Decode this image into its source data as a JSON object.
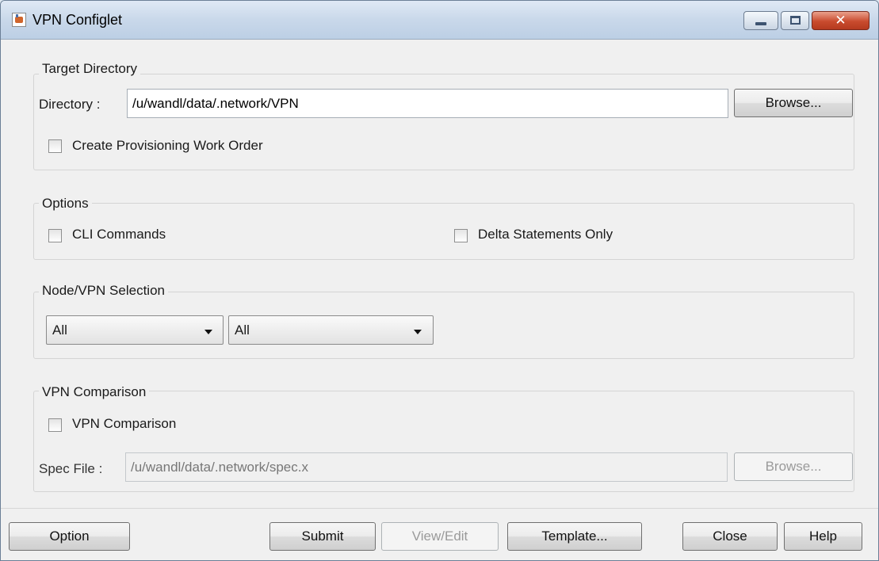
{
  "window": {
    "title": "VPN Configlet"
  },
  "target_directory": {
    "group_title": "Target Directory",
    "directory_label": "Directory :",
    "directory_value": "/u/wandl/data/.network/VPN",
    "browse_label": "Browse...",
    "create_work_order_label": "Create Provisioning Work Order"
  },
  "options": {
    "group_title": "Options",
    "cli_commands_label": "CLI Commands",
    "delta_statements_label": "Delta Statements Only"
  },
  "selection": {
    "group_title": "Node/VPN Selection",
    "node_value": "All",
    "vpn_value": "All"
  },
  "comparison": {
    "group_title": "VPN Comparison",
    "checkbox_label": "VPN Comparison",
    "spec_file_label": "Spec File :",
    "spec_file_value": "/u/wandl/data/.network/spec.x",
    "browse_label": "Browse..."
  },
  "footer": {
    "option_label": "Option",
    "submit_label": "Submit",
    "view_edit_label": "View/Edit",
    "template_label": "Template...",
    "close_label": "Close",
    "help_label": "Help"
  }
}
